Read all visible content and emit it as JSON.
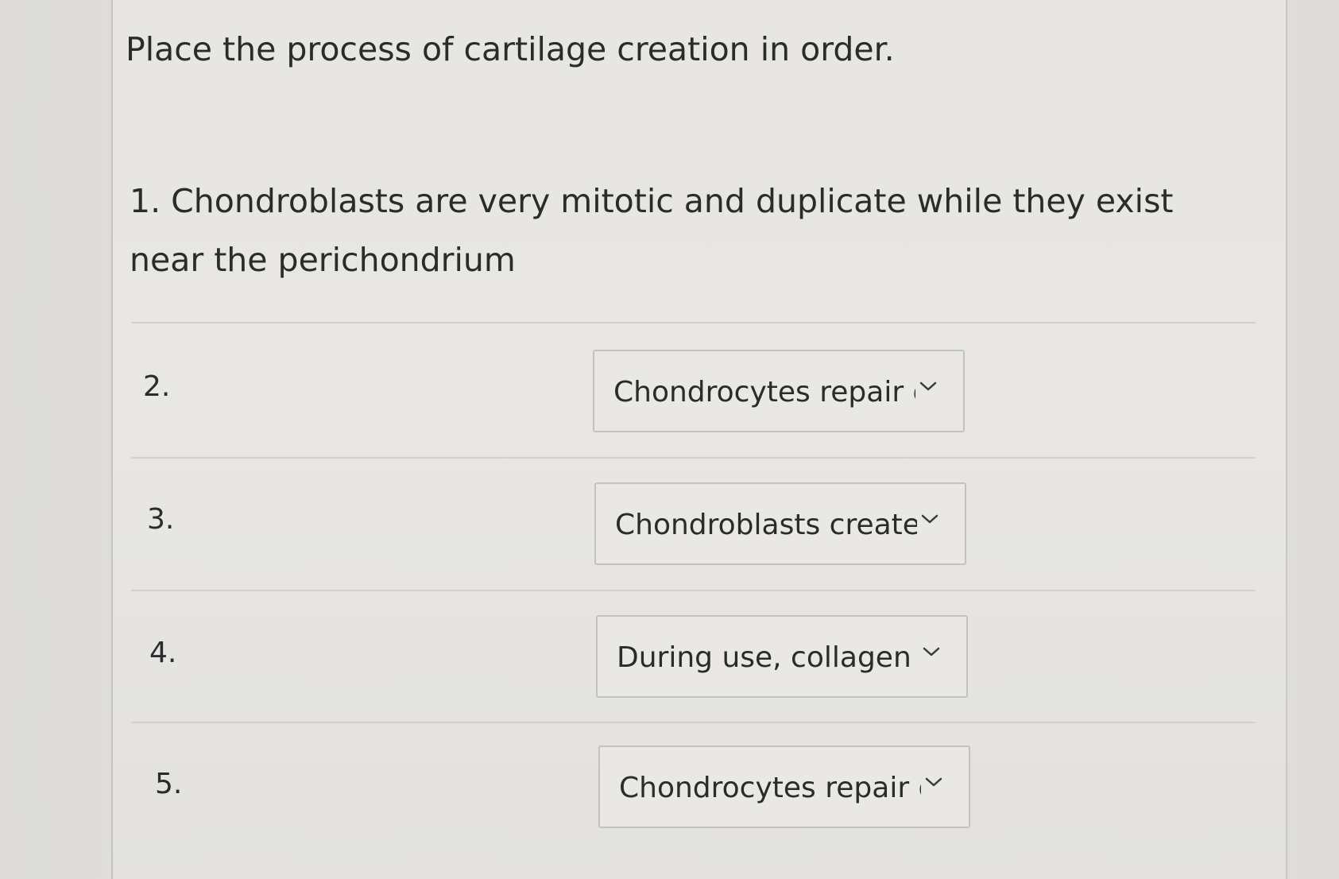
{
  "question": {
    "title": "Place the process of cartilage creation in order."
  },
  "first_step": {
    "text": "1. Chondroblasts are very mitotic and duplicate while they exist near the perichondrium"
  },
  "rows": [
    {
      "number": "2.",
      "selected": "Chondrocytes repair da",
      "icon": "chevron-down-icon"
    },
    {
      "number": "3.",
      "selected": "Chondroblasts create an",
      "icon": "chevron-down-icon"
    },
    {
      "number": "4.",
      "selected": "During use, collagen fib",
      "icon": "chevron-down-icon"
    },
    {
      "number": "5.",
      "selected": "Chondrocytes repair da",
      "icon": "chevron-down-icon"
    }
  ]
}
